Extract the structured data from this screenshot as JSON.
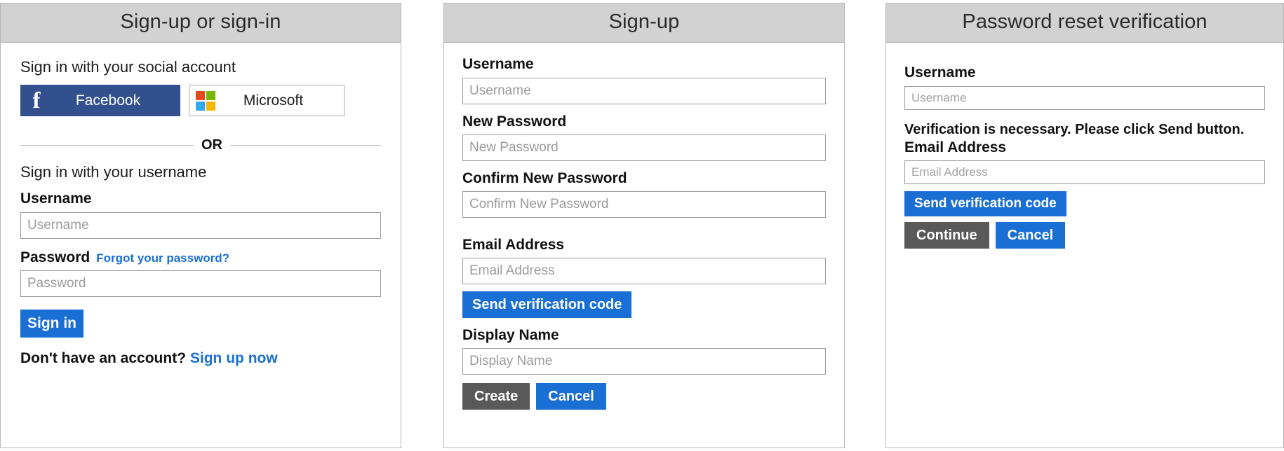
{
  "panels": [
    {
      "title": "Sign-up or sign-in",
      "social_heading": "Sign in with your social account",
      "social_buttons": [
        {
          "label": "Facebook",
          "icon": "facebook-icon",
          "color": "#32508e"
        },
        {
          "label": "Microsoft",
          "icon": "microsoft-icon",
          "color": "#ffffff"
        }
      ],
      "divider_text": "OR",
      "username_heading": "Sign in with your username",
      "username_label": "Username",
      "username_placeholder": "Username",
      "password_label": "Password",
      "password_placeholder": "Password",
      "forgot_link": "Forgot your password?",
      "signin_button": "Sign in",
      "no_account_text": "Don't have an account?",
      "signup_link": "Sign up now"
    },
    {
      "title": "Sign-up",
      "username_label": "Username",
      "username_placeholder": "Username",
      "new_password_label": "New Password",
      "new_password_placeholder": "New Password",
      "confirm_password_label": "Confirm New Password",
      "confirm_password_placeholder": "Confirm New Password",
      "email_label": "Email Address",
      "email_placeholder": "Email Address",
      "send_code_button": "Send verification code",
      "display_name_label": "Display Name",
      "display_name_placeholder": "Display Name",
      "create_button": "Create",
      "cancel_button": "Cancel"
    },
    {
      "title": "Password reset verification",
      "username_label": "Username",
      "username_placeholder": "Username",
      "verification_note": "Verification is necessary. Please click Send button.",
      "email_label": "Email Address",
      "email_placeholder": "Email Address",
      "send_code_button": "Send verification code",
      "continue_button": "Continue",
      "cancel_button": "Cancel"
    }
  ],
  "colors": {
    "accent_blue": "#1a6fd4",
    "grey_button": "#595959",
    "header_grey": "#d2d2d2",
    "facebook_blue": "#32508e",
    "ms_red": "#e8491d",
    "ms_green": "#79b500",
    "ms_blue": "#35a7eb",
    "ms_yellow": "#f8b704",
    "placeholder_grey": "#9b9b9b",
    "border_grey": "#9a9a9a"
  }
}
